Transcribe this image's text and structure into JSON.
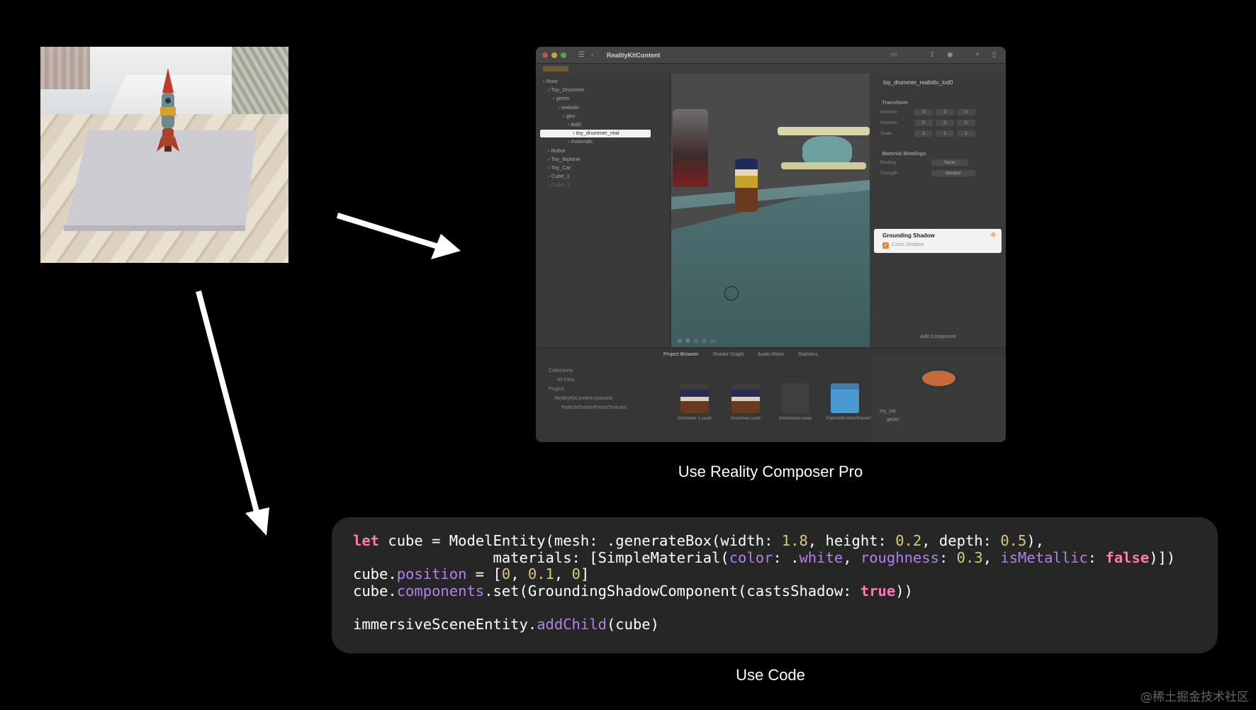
{
  "window": {
    "title": "RealityKitContent",
    "outline": [
      {
        "label": "Root",
        "indent": 0
      },
      {
        "label": "Toy_Drummer",
        "indent": 1
      },
      {
        "label": "geom",
        "indent": 2
      },
      {
        "label": "realistic",
        "indent": 3
      },
      {
        "label": "geo",
        "indent": 4
      },
      {
        "label": "lod0",
        "indent": 5
      },
      {
        "label": "toy_drummer_real",
        "indent": 6,
        "selected": true
      },
      {
        "label": "materials",
        "indent": 5
      },
      {
        "label": "Robot",
        "indent": 1
      },
      {
        "label": "Toy_Biplane",
        "indent": 1
      },
      {
        "label": "Toy_Car",
        "indent": 1
      },
      {
        "label": "Cube_1",
        "indent": 1
      },
      {
        "label": "Cube_1",
        "indent": 1
      }
    ],
    "inspector": {
      "entity_name": "toy_drummer_realistic_lod0",
      "transform_label": "Transform",
      "position_label": "Position",
      "rotation_label": "Rotation",
      "scale_label": "Scale",
      "position": [
        "0",
        "0",
        "0"
      ],
      "rotation": [
        "0",
        "0",
        "0"
      ],
      "scale": [
        "1",
        "1",
        "1"
      ],
      "material_bindings_label": "Material Bindings",
      "binding_label": "Binding",
      "binding_value": "None",
      "strength_label": "Strength",
      "strength_value": "Weaker",
      "grounding_shadow_label": "Grounding Shadow",
      "casts_shadow_label": "Casts Shadow",
      "add_component_label": "Add Component"
    },
    "browser": {
      "tabs": [
        "Project Browser",
        "Shader Graph",
        "Audio Mixer",
        "Statistics"
      ],
      "collections_label": "Collections",
      "all_files_label": "All Files",
      "project_label": "Project",
      "project_item": "RealityKitContent.rkassets",
      "project_subitem": "ParticleEmitterPresetTextures",
      "assets": [
        {
          "name": "Drummer 1.usdz",
          "kind": "drummer"
        },
        {
          "name": "Drummer.usdz",
          "kind": "drummer"
        },
        {
          "name": "Immersive.usda",
          "kind": "scene"
        },
        {
          "name": "ParticleEmitterPresetTex...",
          "kind": "folder"
        }
      ],
      "preview_tree": [
        "toy_car",
        "geom"
      ]
    }
  },
  "captions": {
    "rcp": "Use Reality Composer Pro",
    "code": "Use Code"
  },
  "code_lines": [
    [
      [
        "kw",
        "let"
      ],
      [
        "plain",
        " cube = ModelEntity(mesh: .generateBox(width: "
      ],
      [
        "num",
        "1.8"
      ],
      [
        "plain",
        ", height: "
      ],
      [
        "num",
        "0.2"
      ],
      [
        "plain",
        ", depth: "
      ],
      [
        "num",
        "0.5"
      ],
      [
        "plain",
        "),"
      ]
    ],
    [
      [
        "plain",
        "                materials: [SimpleMaterial("
      ],
      [
        "prop",
        "color"
      ],
      [
        "plain",
        ": ."
      ],
      [
        "prop",
        "white"
      ],
      [
        "plain",
        ", "
      ],
      [
        "prop",
        "roughness"
      ],
      [
        "plain",
        ": "
      ],
      [
        "num",
        "0.3"
      ],
      [
        "plain",
        ", "
      ],
      [
        "prop",
        "isMetallic"
      ],
      [
        "plain",
        ": "
      ],
      [
        "kw",
        "false"
      ],
      [
        "plain",
        ")])"
      ]
    ],
    [
      [
        "plain",
        "cube."
      ],
      [
        "prop",
        "position"
      ],
      [
        "plain",
        " = ["
      ],
      [
        "num",
        "0"
      ],
      [
        "plain",
        ", "
      ],
      [
        "num",
        "0.1"
      ],
      [
        "plain",
        ", "
      ],
      [
        "num",
        "0"
      ],
      [
        "plain",
        "]"
      ]
    ],
    [
      [
        "plain",
        "cube."
      ],
      [
        "prop",
        "components"
      ],
      [
        "plain",
        ".set(GroundingShadowComponent(castsShadow: "
      ],
      [
        "kw",
        "true"
      ],
      [
        "plain",
        "))"
      ]
    ],
    [
      [
        "plain",
        ""
      ]
    ],
    [
      [
        "plain",
        "immersiveSceneEntity."
      ],
      [
        "prop",
        "addChild"
      ],
      [
        "plain",
        "(cube)"
      ]
    ]
  ],
  "watermark": "@稀土掘金技术社区"
}
